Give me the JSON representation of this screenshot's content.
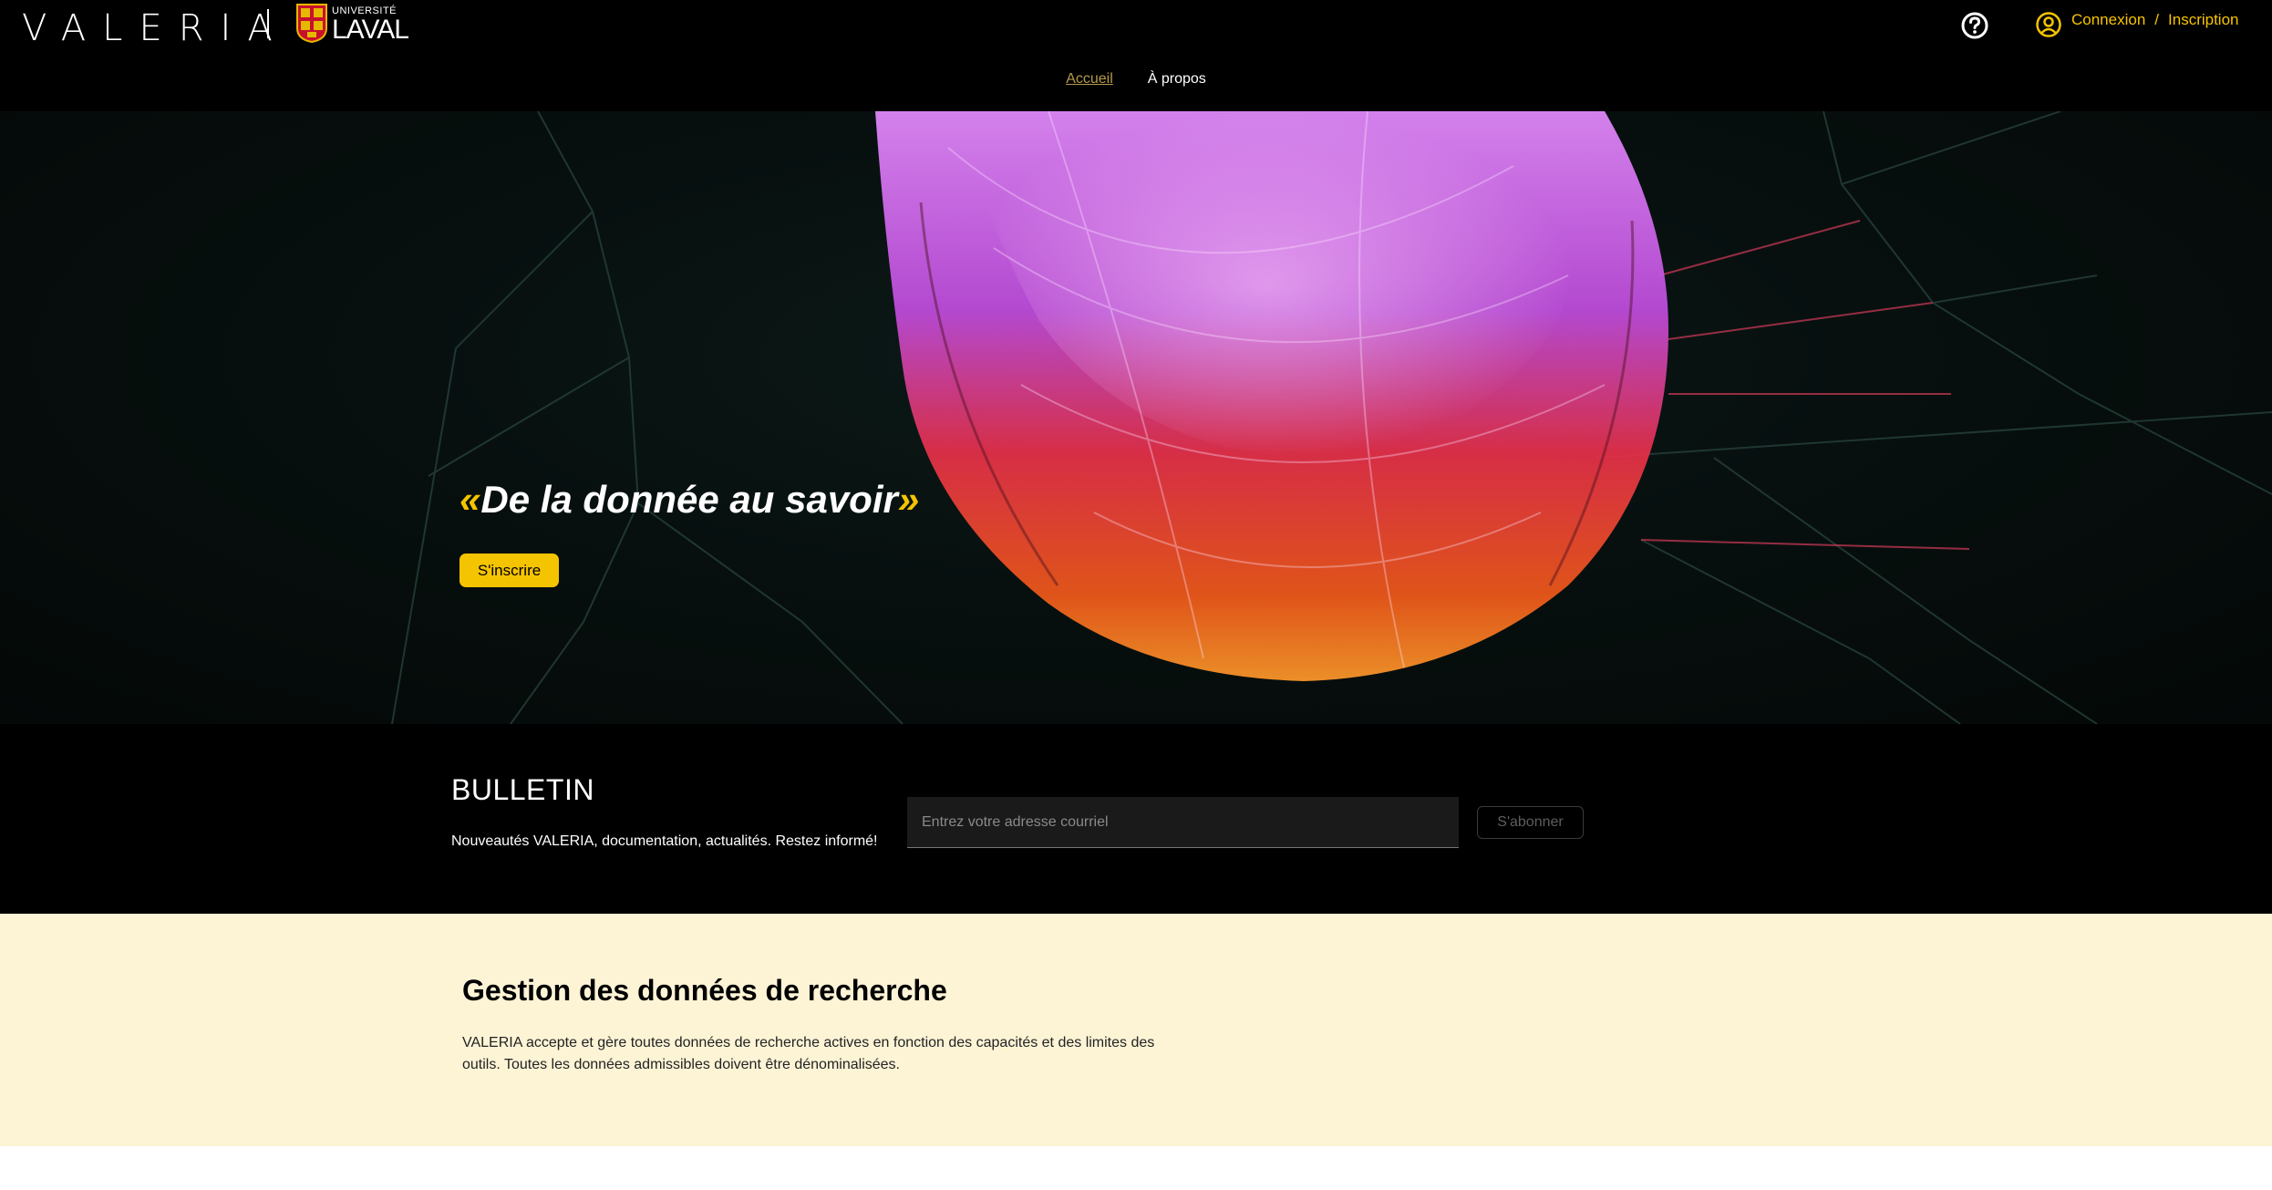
{
  "header": {
    "brand": "VALERIA",
    "ul_logo": {
      "small": "UNIVERSITÉ",
      "big": "LAVAL"
    },
    "auth": {
      "login": "Connexion",
      "separator": "/",
      "register": "Inscription"
    },
    "nav": [
      {
        "label": "Accueil",
        "active": true
      },
      {
        "label": "À propos",
        "active": false
      }
    ],
    "accent_color": "#f5c400"
  },
  "hero": {
    "quote_open": "«",
    "quote_text": "De la donnée au savoir",
    "quote_close": "»",
    "signup_button": "S'inscrire"
  },
  "bulletin": {
    "title": "BULLETIN",
    "subtitle": "Nouveautés VALERIA, documentation, actualités. Restez informé!",
    "email_placeholder": "Entrez votre adresse courriel",
    "subscribe_button": "S'abonner"
  },
  "gestion": {
    "title": "Gestion des données de recherche",
    "body": "VALERIA accepte et gère toutes données de recherche actives en fonction des capacités et des limites des outils. Toutes les données admissibles doivent être dénominalisées."
  },
  "icons": {
    "help": "help-circle-icon",
    "user": "user-circle-icon"
  }
}
